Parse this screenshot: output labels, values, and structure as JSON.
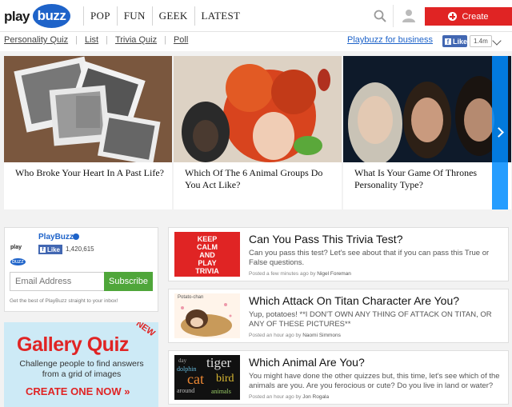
{
  "header": {
    "logo": {
      "play": "play",
      "buzz": "buzz"
    },
    "nav": [
      "POP",
      "FUN",
      "GEEK",
      "LATEST"
    ],
    "create_label": "Create",
    "colors": {
      "brand": "#1e63c9",
      "create": "#e02424"
    }
  },
  "subnav": {
    "links": [
      "Personality Quiz",
      "List",
      "Trivia Quiz",
      "Poll"
    ],
    "business_link": "Playbuzz for business",
    "like_label": "Like",
    "like_count": "1.4m"
  },
  "carousel": [
    {
      "title": "Who Broke Your Heart In A Past Life?"
    },
    {
      "title": "Which Of The 6 Animal Groups Do You Act Like?"
    },
    {
      "title": "What Is Your Game Of Thrones Personality Type?"
    }
  ],
  "fb_widget": {
    "logo": {
      "play": "play",
      "buzz": "buzz"
    },
    "page_name": "PlayBuzz",
    "like_label": "Like",
    "like_count": "1,420,615",
    "email_placeholder": "Email Address",
    "subscribe_label": "Subscribe",
    "note": "Get the best of PlayBuzz straight to your inbox!"
  },
  "promo": {
    "badge": "NEW",
    "title": "Gallery Quiz",
    "subtitle": "Challenge people to find answers from a grid of images",
    "cta": "CREATE ONE NOW »"
  },
  "feed": [
    {
      "thumb_lines": [
        "KEEP",
        "CALM",
        "AND",
        "PLAY",
        "TRIVIA"
      ],
      "title": "Can You Pass This Trivia Test?",
      "desc": "Can you pass this test? Let's see about that if you can pass this True or False questions.",
      "meta_prefix": "Posted a few minutes ago by",
      "author": "Nigel Foreman"
    },
    {
      "thumb_caption": "Potato-chan",
      "title": "Which Attack On Titan Character Are You?",
      "desc": "Yup, potatoes! **I DON'T OWN ANY THING OF ATTACK ON TITAN, OR ANY OF THESE PICTURES**",
      "meta_prefix": "Posted an hour ago by",
      "author": "Naomi Simmons"
    },
    {
      "thumb_words": [
        "tiger",
        "dolphin",
        "cat",
        "bird",
        "day",
        "around",
        "animals"
      ],
      "title": "Which Animal Are You?",
      "desc": "You might have done the other quizzes but, this time, let's see which of the animals are you. Are you ferocious or cute? Do you live in land or water?",
      "meta_prefix": "Posted an hour ago by",
      "author": "Jon Rogala"
    }
  ]
}
